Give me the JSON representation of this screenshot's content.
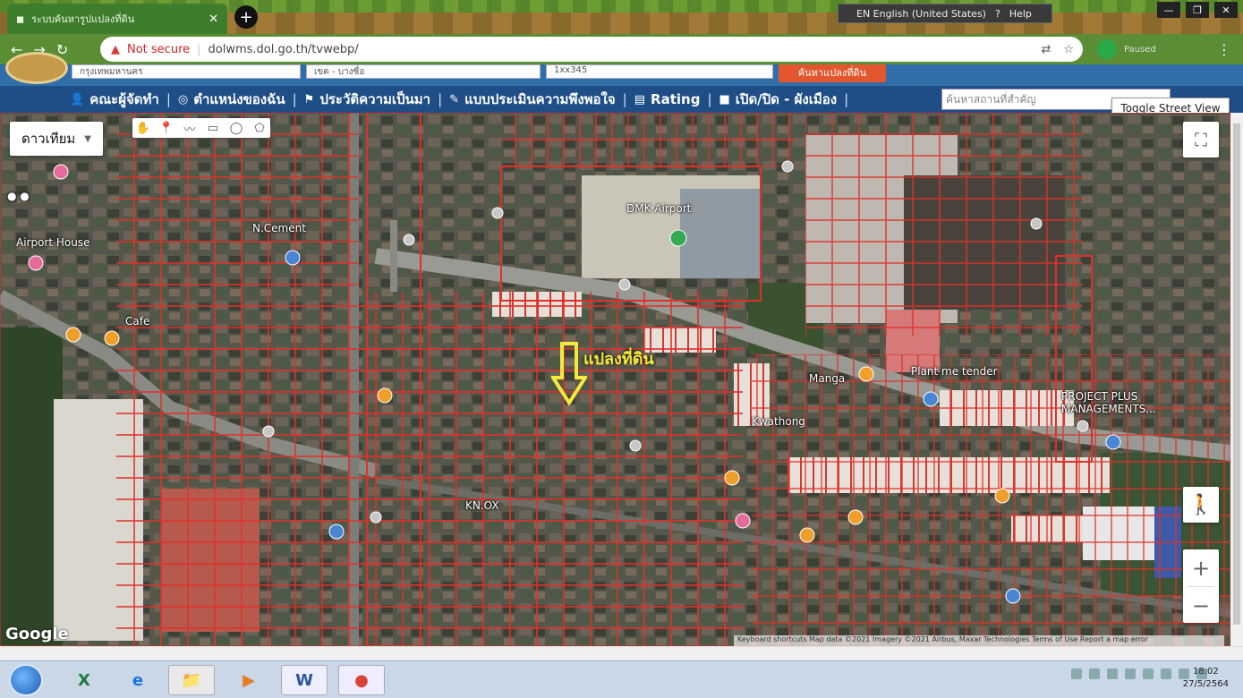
{
  "browser": {
    "tab_title": "ระบบค้นหารูปแปลงที่ดิน",
    "new_tab_symbol": "+",
    "language_toggle": "EN English (United States)",
    "help_label": "Help",
    "window_controls": [
      "—",
      "❐",
      "✕"
    ],
    "nav_back": "←",
    "nav_forward": "→",
    "nav_reload": "↻",
    "security_label": "Not secure",
    "url": "dolwms.dol.go.th/tvwebp/",
    "profile_name": "Paused"
  },
  "site": {
    "filters": {
      "province": "กรุงเทพมหานคร",
      "district": "เขต - บางซื่อ",
      "parcel": "1xx345",
      "search_button": "ค้นหาแปลงที่ดิน"
    },
    "nav": [
      {
        "icon": "user-icon",
        "label": "คณะผู้จัดทำ"
      },
      {
        "icon": "location-icon",
        "label": "ตำแหน่งของฉัน"
      },
      {
        "icon": "history-icon",
        "label": "ประวัติความเป็นมา"
      },
      {
        "icon": "survey-icon",
        "label": "แบบประเมินความพึงพอใจ"
      },
      {
        "icon": "rating-icon",
        "label": "Rating"
      },
      {
        "icon": "toggle-icon",
        "label": "เปิด/ปิด - ผังเมือง"
      }
    ],
    "place_search_placeholder": "ค้นหาสถานที่สำคัญ",
    "toggle_street_view": "Toggle Street View"
  },
  "map": {
    "map_type": "ดาวเทียม",
    "fullscreen_icon": "⛶",
    "zoom_in": "+",
    "zoom_out": "−",
    "google_logo": "Google",
    "attribution": "Keyboard shortcuts   Map data ©2021   Imagery ©2021 Airbus, Maxar Technologies   Terms of Use   Report a map error",
    "parcel_label": "แปลงที่ดิน",
    "places": [
      {
        "name": "DMK Airport"
      },
      {
        "name": "Airport House"
      },
      {
        "name": "Cafe"
      },
      {
        "name": "N.Cement"
      },
      {
        "name": "Plant me tender"
      },
      {
        "name": "PROJECT PLUS"
      },
      {
        "name": "MANAGEMENTS..."
      },
      {
        "name": "Manga"
      },
      {
        "name": "Kwathong"
      },
      {
        "name": "KN.OX"
      }
    ]
  },
  "taskbar": {
    "apps": [
      "X",
      "e",
      "📁",
      "▶",
      "W",
      "●"
    ],
    "clock_time": "18:02",
    "clock_date": "27/5/2564"
  },
  "colors": {
    "parcel_line": "#e0302a",
    "nav_bg": "#1f4e86",
    "accent_orange": "#e4572e",
    "arrow_yellow": "#f5e93b"
  }
}
